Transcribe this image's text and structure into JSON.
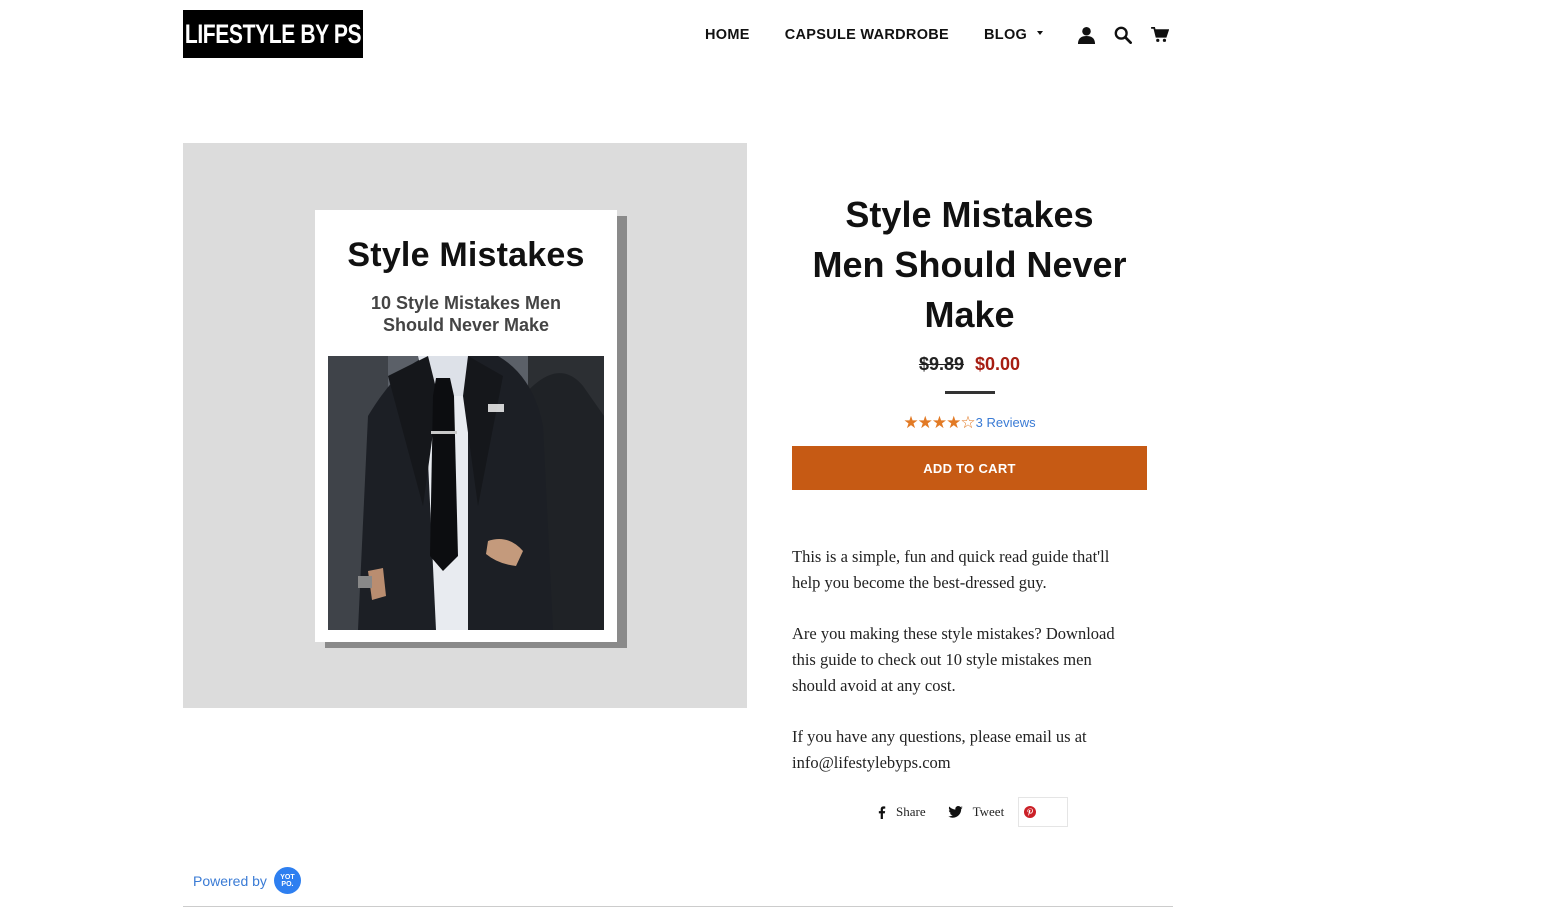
{
  "header": {
    "logo_text": "LIFESTYLE BY PS",
    "nav": {
      "home": "HOME",
      "capsule": "CAPSULE WARDROBE",
      "blog": "BLOG"
    },
    "icons": [
      "account-icon",
      "search-icon",
      "cart-icon"
    ]
  },
  "product": {
    "cover": {
      "title": "Style Mistakes",
      "subtitle_line1": "10 Style Mistakes Men",
      "subtitle_line2": "Should Never Make"
    },
    "title_line1": "Style Mistakes",
    "title_line2": "Men Should Never",
    "title_line3": "Make",
    "old_price": "$9.89",
    "price": "$0.00",
    "rating": 4,
    "reviews_label": "3 Reviews",
    "add_to_cart": "ADD TO CART",
    "description": {
      "p1": "This is a simple, fun and quick read guide that'll help you become the best-dressed guy.",
      "p2": "Are you making these style mistakes? Download this guide to check out 10 style mistakes men should avoid at any cost.",
      "p3": "If you have any questions, please email us at info@lifestylebyps.com"
    },
    "share": {
      "share_label": "Share",
      "tweet_label": "Tweet"
    }
  },
  "footer": {
    "powered_by": "Powered by",
    "yotpo_text": "YOT PO."
  },
  "colors": {
    "accent": "#c65a14",
    "sale_price": "#a61d12",
    "stars": "#e27a25",
    "link": "#3a7bd5"
  }
}
